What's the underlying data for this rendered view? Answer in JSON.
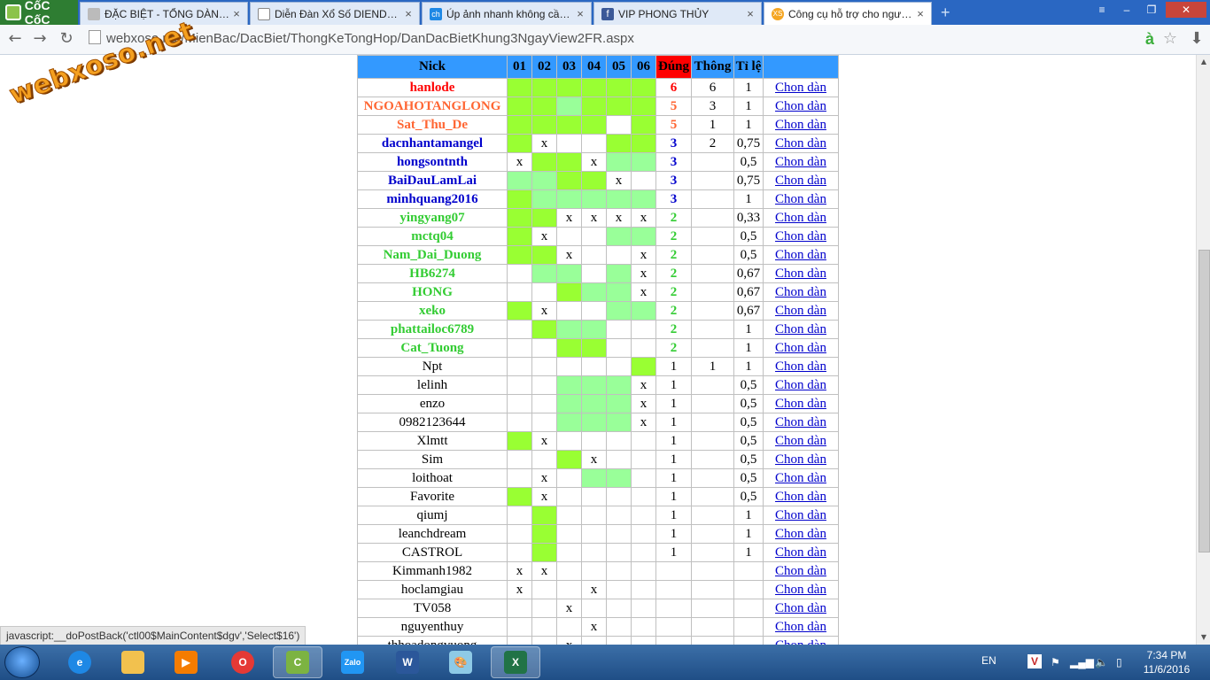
{
  "browser": {
    "brand": "CốC CốC",
    "tabs": [
      {
        "title": "ĐẶC BIỆT - TỔNG DÀN ĐẶC BIỆT",
        "active": false
      },
      {
        "title": "Diễn Đàn Xổ Số DIENDANXOSO",
        "active": false
      },
      {
        "title": "Úp ảnh nhanh không cần đăng ký",
        "active": false
      },
      {
        "title": "VIP PHONG THỦY",
        "active": false
      },
      {
        "title": "Công cụ hỗ trợ cho người chơi",
        "active": true
      }
    ],
    "url": "webxoso.net/MienBac/DacBiet/ThongKeTongHop/DanDacBietKhung3NgayView2FR.aspx",
    "watermark": "webxoso.net",
    "status_text": "javascript:__doPostBack('ctl00$MainContent$dgv','Select$16')"
  },
  "colors": {
    "header": "#3399ff",
    "dung_header": "#ff0000",
    "green_strong": "#99ff33",
    "green_light": "#99ff99",
    "red": "#ff0000",
    "orange": "#ff6633",
    "blue": "#0000cc",
    "green": "#33cc33"
  },
  "table": {
    "headers": {
      "nick": "Nick",
      "days": [
        "01",
        "02",
        "03",
        "04",
        "05",
        "06"
      ],
      "dung": "Đúng",
      "thong": "Thông",
      "tile": "Tỉ lệ"
    },
    "link_label": "Chon dàn",
    "rows": [
      {
        "nick": "hanlode",
        "color": "red",
        "cells": [
          "g1",
          "g1",
          "g1",
          "g1",
          "g1",
          "g1"
        ],
        "dung": "6",
        "thong": "6",
        "tile": "1"
      },
      {
        "nick": "NGOAHOTANGLONG",
        "color": "orange",
        "cells": [
          "g1",
          "g1",
          "g2",
          "g1",
          "g1",
          "g1"
        ],
        "dung": "5",
        "thong": "3",
        "tile": "1"
      },
      {
        "nick": "Sat_Thu_De",
        "color": "orange",
        "cells": [
          "g1",
          "g1",
          "g1",
          "g1",
          "",
          "g1"
        ],
        "dung": "5",
        "thong": "1",
        "tile": "1"
      },
      {
        "nick": "dacnhantamangel",
        "color": "blue",
        "cells": [
          "g1",
          "x",
          "",
          "",
          "g1",
          "g1"
        ],
        "dung": "3",
        "thong": "2",
        "tile": "0,75"
      },
      {
        "nick": "hongsontnth",
        "color": "blue",
        "cells": [
          "x",
          "g1",
          "g1",
          "x",
          "g2",
          "g2"
        ],
        "dung": "3",
        "thong": "",
        "tile": "0,5"
      },
      {
        "nick": "BaiDauLamLai",
        "color": "blue",
        "cells": [
          "g2",
          "g2",
          "g1",
          "g1",
          "x",
          ""
        ],
        "dung": "3",
        "thong": "",
        "tile": "0,75"
      },
      {
        "nick": "minhquang2016",
        "color": "blue",
        "cells": [
          "g1",
          "g2",
          "g2",
          "g2",
          "g2",
          "g2"
        ],
        "dung": "3",
        "thong": "",
        "tile": "1"
      },
      {
        "nick": "yingyang07",
        "color": "green",
        "cells": [
          "g1",
          "g1",
          "x",
          "x",
          "x",
          "x"
        ],
        "dung": "2",
        "thong": "",
        "tile": "0,33"
      },
      {
        "nick": "mctq04",
        "color": "green",
        "cells": [
          "g1",
          "x",
          "",
          "",
          "g2",
          "g2"
        ],
        "dung": "2",
        "thong": "",
        "tile": "0,5"
      },
      {
        "nick": "Nam_Dai_Duong",
        "color": "green",
        "cells": [
          "g1",
          "g1",
          "x",
          "",
          "",
          "x"
        ],
        "dung": "2",
        "thong": "",
        "tile": "0,5"
      },
      {
        "nick": "HB6274",
        "color": "green",
        "cells": [
          "",
          "g2",
          "g2",
          "",
          "g2",
          "x"
        ],
        "dung": "2",
        "thong": "",
        "tile": "0,67"
      },
      {
        "nick": "HONG",
        "color": "green",
        "cells": [
          "",
          "",
          "g1",
          "g2",
          "g2",
          "x"
        ],
        "dung": "2",
        "thong": "",
        "tile": "0,67"
      },
      {
        "nick": "xeko",
        "color": "green",
        "cells": [
          "g1",
          "x",
          "",
          "",
          "g2",
          "g2"
        ],
        "dung": "2",
        "thong": "",
        "tile": "0,67"
      },
      {
        "nick": "phattailoc6789",
        "color": "green",
        "cells": [
          "",
          "g1",
          "g2",
          "g2",
          "",
          ""
        ],
        "dung": "2",
        "thong": "",
        "tile": "1"
      },
      {
        "nick": "Cat_Tuong",
        "color": "green",
        "cells": [
          "",
          "",
          "g1",
          "g1",
          "",
          ""
        ],
        "dung": "2",
        "thong": "",
        "tile": "1"
      },
      {
        "nick": "Npt",
        "color": "plain",
        "cells": [
          "",
          "",
          "",
          "",
          "",
          "g1"
        ],
        "dung": "1",
        "thong": "1",
        "tile": "1"
      },
      {
        "nick": "lelinh",
        "color": "plain",
        "cells": [
          "",
          "",
          "g2",
          "g2",
          "g2",
          "x"
        ],
        "dung": "1",
        "thong": "",
        "tile": "0,5"
      },
      {
        "nick": "enzo",
        "color": "plain",
        "cells": [
          "",
          "",
          "g2",
          "g2",
          "g2",
          "x"
        ],
        "dung": "1",
        "thong": "",
        "tile": "0,5"
      },
      {
        "nick": "0982123644",
        "color": "plain",
        "cells": [
          "",
          "",
          "g2",
          "g2",
          "g2",
          "x"
        ],
        "dung": "1",
        "thong": "",
        "tile": "0,5"
      },
      {
        "nick": "Xlmtt",
        "color": "plain",
        "cells": [
          "g1",
          "x",
          "",
          "",
          "",
          ""
        ],
        "dung": "1",
        "thong": "",
        "tile": "0,5"
      },
      {
        "nick": "Sim",
        "color": "plain",
        "cells": [
          "",
          "",
          "g1",
          "x",
          "",
          ""
        ],
        "dung": "1",
        "thong": "",
        "tile": "0,5"
      },
      {
        "nick": "loithoat",
        "color": "plain",
        "cells": [
          "",
          "x",
          "",
          "g2",
          "g2",
          ""
        ],
        "dung": "1",
        "thong": "",
        "tile": "0,5"
      },
      {
        "nick": "Favorite",
        "color": "plain",
        "cells": [
          "g1",
          "x",
          "",
          "",
          "",
          ""
        ],
        "dung": "1",
        "thong": "",
        "tile": "0,5"
      },
      {
        "nick": "qiumj",
        "color": "plain",
        "cells": [
          "",
          "g1",
          "",
          "",
          "",
          ""
        ],
        "dung": "1",
        "thong": "",
        "tile": "1"
      },
      {
        "nick": "leanchdream",
        "color": "plain",
        "cells": [
          "",
          "g1",
          "",
          "",
          "",
          ""
        ],
        "dung": "1",
        "thong": "",
        "tile": "1"
      },
      {
        "nick": "CASTROL",
        "color": "plain",
        "cells": [
          "",
          "g1",
          "",
          "",
          "",
          ""
        ],
        "dung": "1",
        "thong": "",
        "tile": "1"
      },
      {
        "nick": "Kimmanh1982",
        "color": "plain",
        "cells": [
          "x",
          "x",
          "",
          "",
          "",
          ""
        ],
        "dung": "",
        "thong": "",
        "tile": ""
      },
      {
        "nick": "hoclamgiau",
        "color": "plain",
        "cells": [
          "x",
          "",
          "",
          "x",
          "",
          ""
        ],
        "dung": "",
        "thong": "",
        "tile": ""
      },
      {
        "nick": "TV058",
        "color": "plain",
        "cells": [
          "",
          "",
          "x",
          "",
          "",
          ""
        ],
        "dung": "",
        "thong": "",
        "tile": ""
      },
      {
        "nick": "nguyenthuy",
        "color": "plain",
        "cells": [
          "",
          "",
          "",
          "x",
          "",
          ""
        ],
        "dung": "",
        "thong": "",
        "tile": ""
      },
      {
        "nick": "thhoadongvuong",
        "color": "plain",
        "cells": [
          "",
          "",
          "x",
          "",
          "",
          ""
        ],
        "dung": "",
        "thong": "",
        "tile": ""
      }
    ]
  },
  "taskbar": {
    "apps": [
      "Internet Explorer",
      "File Explorer",
      "Media Player",
      "Opera",
      "Cốc Cốc",
      "Zalo",
      "Word",
      "Paint",
      "Excel"
    ],
    "language": "EN",
    "time": "7:34 PM",
    "date": "11/6/2016"
  }
}
